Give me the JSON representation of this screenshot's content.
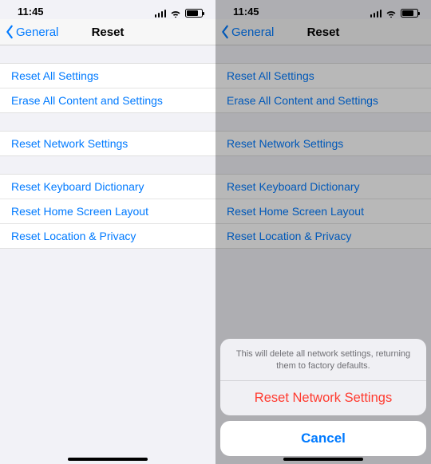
{
  "status": {
    "time": "11:45"
  },
  "nav": {
    "back_label": "General",
    "title": "Reset"
  },
  "rows": {
    "reset_all": "Reset All Settings",
    "erase_all": "Erase All Content and Settings",
    "reset_network": "Reset Network Settings",
    "reset_keyboard": "Reset Keyboard Dictionary",
    "reset_home": "Reset Home Screen Layout",
    "reset_privacy": "Reset Location & Privacy"
  },
  "sheet": {
    "message": "This will delete all network settings, returning them to factory defaults.",
    "action": "Reset Network Settings",
    "cancel": "Cancel"
  }
}
